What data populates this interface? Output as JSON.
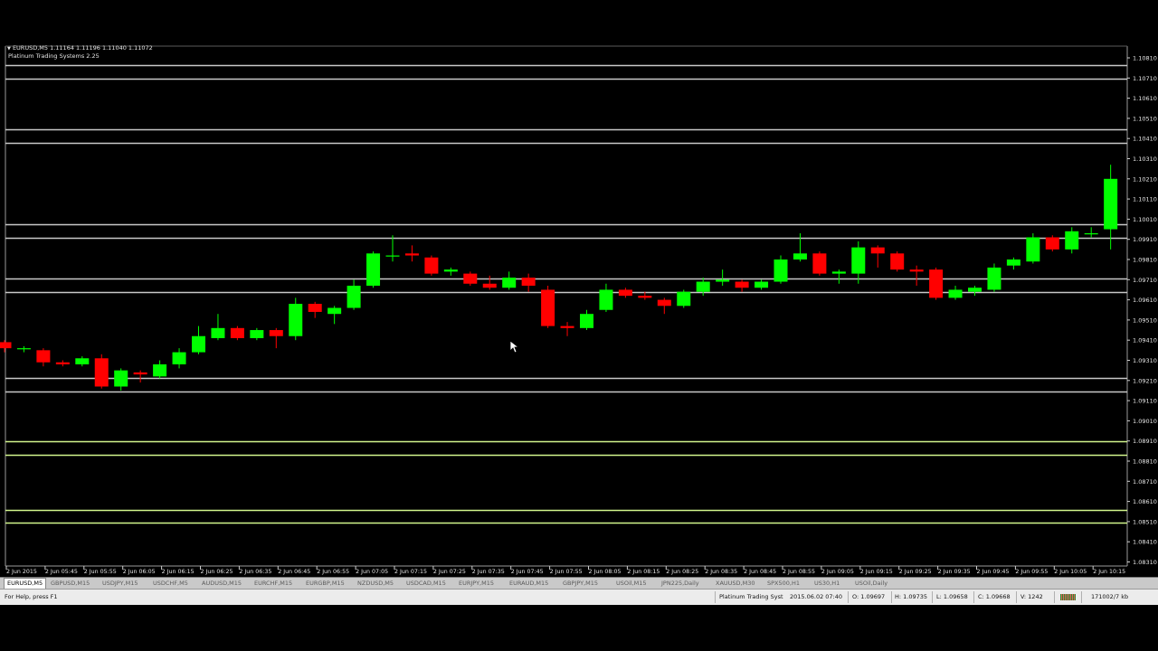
{
  "chart_header": {
    "symbol_line": "EURUSD,M5  1.11164 1.11196 1.11040 1.11072",
    "indicator_name": "Platinum Trading Systems 2.25"
  },
  "chart_data": {
    "type": "candlestick",
    "symbol": "EURUSD",
    "timeframe": "M5",
    "ylim": [
      1.0827,
      1.0826,
      1.0827
    ],
    "price_axis_ticks": [
      "1.10810",
      "1.10710",
      "1.10610",
      "1.10510",
      "1.10410",
      "1.10310",
      "1.10210",
      "1.10110",
      "1.10010",
      "1.09910",
      "1.09810",
      "1.09710",
      "1.09610",
      "1.09510",
      "1.09410",
      "1.09310",
      "1.09210",
      "1.09110",
      "1.09010",
      "1.08910",
      "1.08810",
      "1.08710",
      "1.08610",
      "1.08510",
      "1.08410",
      "1.08310"
    ],
    "time_axis_labels": [
      "2 Jun 2015",
      "2 Jun 05:45",
      "2 Jun 05:55",
      "2 Jun 06:05",
      "2 Jun 06:15",
      "2 Jun 06:25",
      "2 Jun 06:35",
      "2 Jun 06:45",
      "2 Jun 06:55",
      "2 Jun 07:05",
      "2 Jun 07:15",
      "2 Jun 07:25",
      "2 Jun 07:35",
      "2 Jun 07:45",
      "2 Jun 07:55",
      "2 Jun 08:05",
      "2 Jun 08:15",
      "2 Jun 08:25",
      "2 Jun 08:35",
      "2 Jun 08:45",
      "2 Jun 08:55",
      "2 Jun 09:05",
      "2 Jun 09:15",
      "2 Jun 09:25",
      "2 Jun 09:35",
      "2 Jun 09:45",
      "2 Jun 09:55",
      "2 Jun 10:05",
      "2 Jun 10:15"
    ],
    "horizontal_levels": [
      {
        "price": 1.10774,
        "color": "#c8c8c8"
      },
      {
        "price": 1.10708,
        "color": "#c8c8c8"
      },
      {
        "price": 1.10454,
        "color": "#c8c8c8"
      },
      {
        "price": 1.10387,
        "color": "#c8c8c8"
      },
      {
        "price": 1.09983,
        "color": "#c8c8c8"
      },
      {
        "price": 1.09916,
        "color": "#c8c8c8"
      },
      {
        "price": 1.09714,
        "color": "#c8c8c8"
      },
      {
        "price": 1.09647,
        "color": "#c8c8c8"
      },
      {
        "price": 1.09221,
        "color": "#c8c8c8"
      },
      {
        "price": 1.09154,
        "color": "#c8c8c8"
      },
      {
        "price": 1.08907,
        "color": "#d2f58c"
      },
      {
        "price": 1.0884,
        "color": "#d2f58c"
      },
      {
        "price": 1.0857,
        "color": "#d2f58c"
      },
      {
        "price": 1.08503,
        "color": "#d2f58c"
      }
    ],
    "candles": [
      {
        "o": 1.094,
        "h": 1.0941,
        "l": 1.0935,
        "c": 1.0937
      },
      {
        "o": 1.0937,
        "h": 1.0938,
        "l": 1.0935,
        "c": 1.0937
      },
      {
        "o": 1.0936,
        "h": 1.0937,
        "l": 1.0928,
        "c": 1.093
      },
      {
        "o": 1.093,
        "h": 1.0931,
        "l": 1.0928,
        "c": 1.0929
      },
      {
        "o": 1.0929,
        "h": 1.0933,
        "l": 1.0928,
        "c": 1.0932
      },
      {
        "o": 1.0932,
        "h": 1.0934,
        "l": 1.0917,
        "c": 1.0918
      },
      {
        "o": 1.0918,
        "h": 1.0927,
        "l": 1.0916,
        "c": 1.0926
      },
      {
        "o": 1.0925,
        "h": 1.0926,
        "l": 1.092,
        "c": 1.0924
      },
      {
        "o": 1.0923,
        "h": 1.0931,
        "l": 1.0922,
        "c": 1.0929
      },
      {
        "o": 1.0929,
        "h": 1.0937,
        "l": 1.0927,
        "c": 1.0935
      },
      {
        "o": 1.0935,
        "h": 1.0948,
        "l": 1.0934,
        "c": 1.0943
      },
      {
        "o": 1.0942,
        "h": 1.0954,
        "l": 1.0941,
        "c": 1.0947
      },
      {
        "o": 1.0947,
        "h": 1.0948,
        "l": 1.0941,
        "c": 1.0942
      },
      {
        "o": 1.0942,
        "h": 1.0947,
        "l": 1.0941,
        "c": 1.0946
      },
      {
        "o": 1.0946,
        "h": 1.0947,
        "l": 1.0937,
        "c": 1.0943
      },
      {
        "o": 1.0943,
        "h": 1.0962,
        "l": 1.0941,
        "c": 1.0959
      },
      {
        "o": 1.0959,
        "h": 1.096,
        "l": 1.0952,
        "c": 1.0955
      },
      {
        "o": 1.0954,
        "h": 1.0958,
        "l": 1.0949,
        "c": 1.0957
      },
      {
        "o": 1.0957,
        "h": 1.0971,
        "l": 1.0956,
        "c": 1.0968
      },
      {
        "o": 1.0968,
        "h": 1.0985,
        "l": 1.0967,
        "c": 1.0984
      },
      {
        "o": 1.0983,
        "h": 1.0993,
        "l": 1.098,
        "c": 1.0983
      },
      {
        "o": 1.0984,
        "h": 1.0988,
        "l": 1.098,
        "c": 1.0983
      },
      {
        "o": 1.0982,
        "h": 1.0983,
        "l": 1.0973,
        "c": 1.0974
      },
      {
        "o": 1.0975,
        "h": 1.0977,
        "l": 1.0973,
        "c": 1.0976
      },
      {
        "o": 1.0974,
        "h": 1.0975,
        "l": 1.0968,
        "c": 1.0969
      },
      {
        "o": 1.0969,
        "h": 1.0973,
        "l": 1.0966,
        "c": 1.0967
      },
      {
        "o": 1.0967,
        "h": 1.0975,
        "l": 1.0966,
        "c": 1.0972
      },
      {
        "o": 1.0972,
        "h": 1.0974,
        "l": 1.0965,
        "c": 1.0968
      },
      {
        "o": 1.0966,
        "h": 1.0968,
        "l": 1.0947,
        "c": 1.0948
      },
      {
        "o": 1.0948,
        "h": 1.095,
        "l": 1.0943,
        "c": 1.0947
      },
      {
        "o": 1.0947,
        "h": 1.0956,
        "l": 1.0946,
        "c": 1.0954
      },
      {
        "o": 1.0956,
        "h": 1.0969,
        "l": 1.0955,
        "c": 1.0966
      },
      {
        "o": 1.0966,
        "h": 1.0967,
        "l": 1.0962,
        "c": 1.0963
      },
      {
        "o": 1.0963,
        "h": 1.0965,
        "l": 1.0961,
        "c": 1.0962
      },
      {
        "o": 1.0961,
        "h": 1.0962,
        "l": 1.0954,
        "c": 1.0958
      },
      {
        "o": 1.0958,
        "h": 1.0966,
        "l": 1.0957,
        "c": 1.0965
      },
      {
        "o": 1.0965,
        "h": 1.0972,
        "l": 1.0963,
        "c": 1.097
      },
      {
        "o": 1.097,
        "h": 1.0976,
        "l": 1.0968,
        "c": 1.0971
      },
      {
        "o": 1.097,
        "h": 1.0971,
        "l": 1.0965,
        "c": 1.0967
      },
      {
        "o": 1.0967,
        "h": 1.0971,
        "l": 1.0966,
        "c": 1.097
      },
      {
        "o": 1.097,
        "h": 1.0983,
        "l": 1.0969,
        "c": 1.0981
      },
      {
        "o": 1.0981,
        "h": 1.0994,
        "l": 1.098,
        "c": 1.0984
      },
      {
        "o": 1.0984,
        "h": 1.0985,
        "l": 1.0973,
        "c": 1.0974
      },
      {
        "o": 1.0974,
        "h": 1.0976,
        "l": 1.0969,
        "c": 1.0975
      },
      {
        "o": 1.0974,
        "h": 1.099,
        "l": 1.0969,
        "c": 1.0987
      },
      {
        "o": 1.0987,
        "h": 1.0988,
        "l": 1.0977,
        "c": 1.0984
      },
      {
        "o": 1.0984,
        "h": 1.0985,
        "l": 1.0975,
        "c": 1.0976
      },
      {
        "o": 1.0976,
        "h": 1.0978,
        "l": 1.0968,
        "c": 1.0975
      },
      {
        "o": 1.0976,
        "h": 1.0977,
        "l": 1.0961,
        "c": 1.0962
      },
      {
        "o": 1.0962,
        "h": 1.0968,
        "l": 1.0961,
        "c": 1.0966
      },
      {
        "o": 1.0965,
        "h": 1.0968,
        "l": 1.0963,
        "c": 1.0967
      },
      {
        "o": 1.0966,
        "h": 1.0979,
        "l": 1.0965,
        "c": 1.0977
      },
      {
        "o": 1.0978,
        "h": 1.0982,
        "l": 1.0976,
        "c": 1.0981
      },
      {
        "o": 1.098,
        "h": 1.0994,
        "l": 1.0979,
        "c": 1.0992
      },
      {
        "o": 1.0992,
        "h": 1.0993,
        "l": 1.0985,
        "c": 1.0986
      },
      {
        "o": 1.0986,
        "h": 1.0997,
        "l": 1.0984,
        "c": 1.0995
      },
      {
        "o": 1.0994,
        "h": 1.0997,
        "l": 1.0992,
        "c": 1.0994
      },
      {
        "o": 1.0996,
        "h": 1.1028,
        "l": 1.0986,
        "c": 1.1021
      }
    ],
    "bull_color": "#00ff00",
    "bear_color": "#ff0000",
    "grid": false
  },
  "tabs": [
    {
      "label": "EURUSD,M5",
      "active": true
    },
    {
      "label": "GBPUSD,M15",
      "active": false
    },
    {
      "label": "USDJPY,M15",
      "active": false
    },
    {
      "label": "USDCHF,M5",
      "active": false
    },
    {
      "label": "AUDUSD,M15",
      "active": false
    },
    {
      "label": "EURCHF,M15",
      "active": false
    },
    {
      "label": "EURGBP,M15",
      "active": false
    },
    {
      "label": "NZDUSD,M5",
      "active": false
    },
    {
      "label": "USDCAD,M15",
      "active": false
    },
    {
      "label": "EURJPY,M15",
      "active": false
    },
    {
      "label": "EURAUD,M15",
      "active": false
    },
    {
      "label": "GBPJPY,M15",
      "active": false
    },
    {
      "label": "USOil,M15",
      "active": false
    },
    {
      "label": "JPN225,Daily",
      "active": false
    },
    {
      "label": "XAUUSD,M30",
      "active": false
    },
    {
      "label": "SPX500,H1",
      "active": false
    },
    {
      "label": "US30,H1",
      "active": false
    },
    {
      "label": "USOil,Daily",
      "active": false
    }
  ],
  "status": {
    "help": "For Help, press F1",
    "profile": "Platinum Trading Syst",
    "datetime": "2015.06.02 07:40",
    "open": "O: 1.09697",
    "high": "H: 1.09735",
    "low": "L: 1.09658",
    "close": "C: 1.09668",
    "volume": "V: 1242",
    "traffic": "171002/7 kb"
  }
}
